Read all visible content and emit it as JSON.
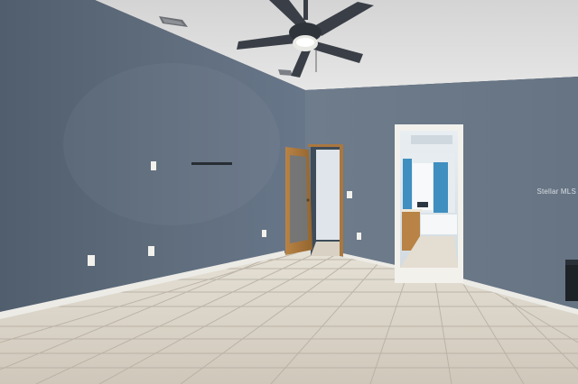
{
  "photo": {
    "watermark": "Stellar MLS",
    "colors": {
      "ceiling": "#dcdcdc",
      "left_wall": "#5c6a7a",
      "back_wall": "#6b7a89",
      "floor_tile": "#d9d2c6",
      "grout": "#bdb5a8",
      "baseboard": "#ecebe6",
      "door_wood": "#a9773f",
      "trim": "#f2f1ec",
      "fan": "#3a3f47",
      "bathroom_accent": "#3f8fc0"
    }
  }
}
